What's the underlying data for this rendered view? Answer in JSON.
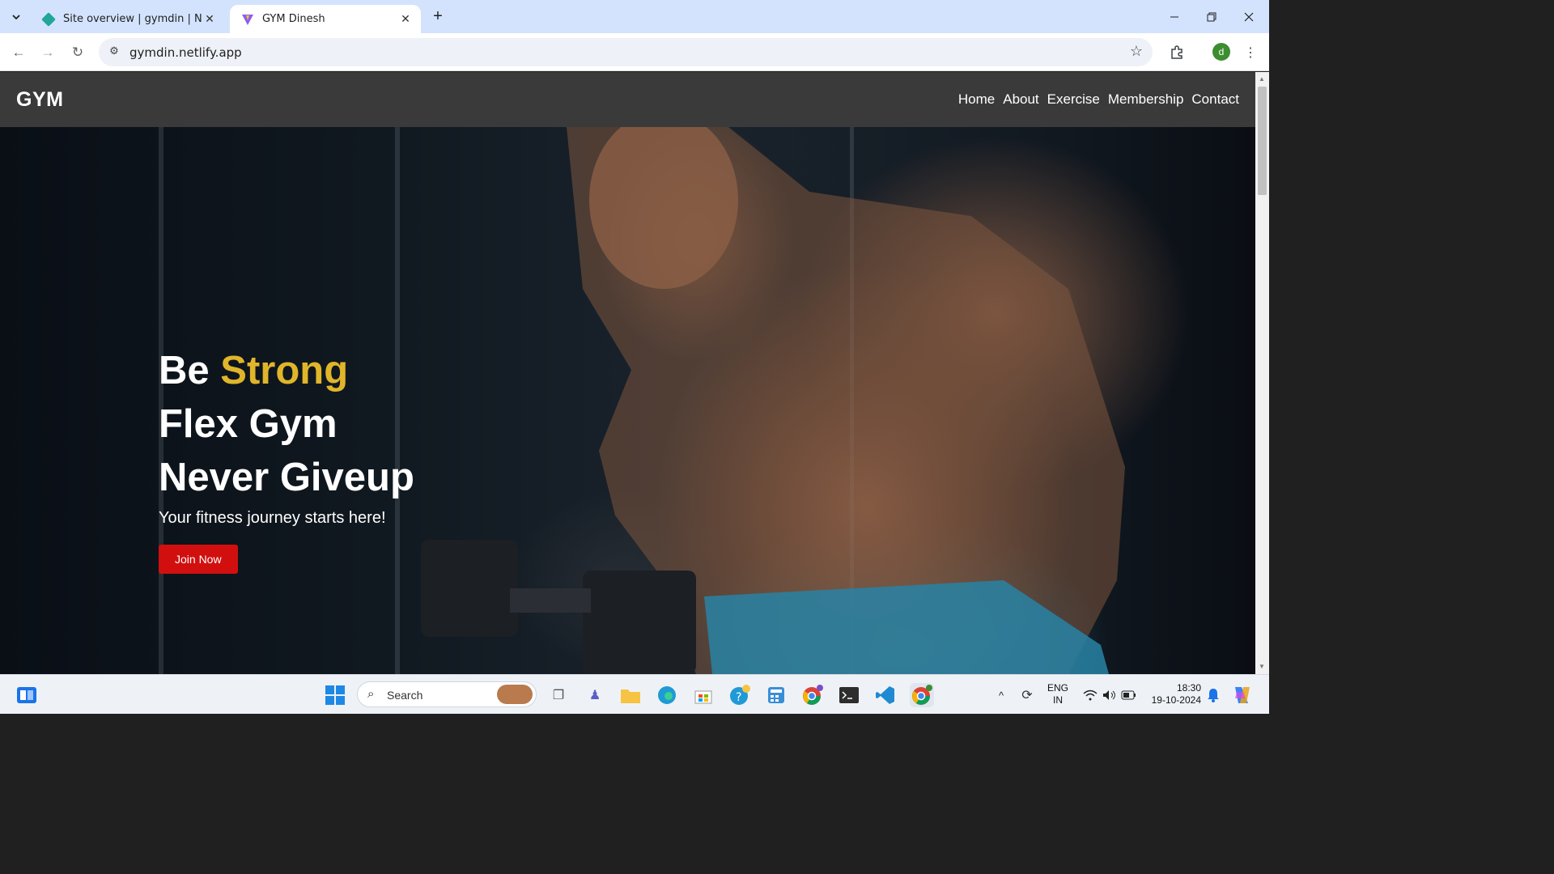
{
  "browser": {
    "tabs": [
      {
        "title": "Site overview | gymdin | Netlify",
        "active": false,
        "favicon": "netlify-icon"
      },
      {
        "title": "GYM Dinesh",
        "active": true,
        "favicon": "vite-icon"
      }
    ],
    "url": "gymdin.netlify.app",
    "profile_initial": "d"
  },
  "site": {
    "logo": "GYM",
    "nav": [
      "Home",
      "About",
      "Exercise",
      "Membership",
      "Contact"
    ],
    "hero": {
      "line1_prefix": "Be",
      "line1_accent": "Strong",
      "line2": "Flex Gym",
      "line3": "Never Giveup",
      "tagline": "Your fitness journey starts here!",
      "cta": "Join Now"
    },
    "colors": {
      "header_bg": "#3a3a3a",
      "accent": "#e0b52a",
      "cta_bg": "#d10f0f"
    }
  },
  "taskbar": {
    "search_label": "Search",
    "language": "ENG",
    "region": "IN",
    "time": "18:30",
    "date": "19-10-2024"
  }
}
